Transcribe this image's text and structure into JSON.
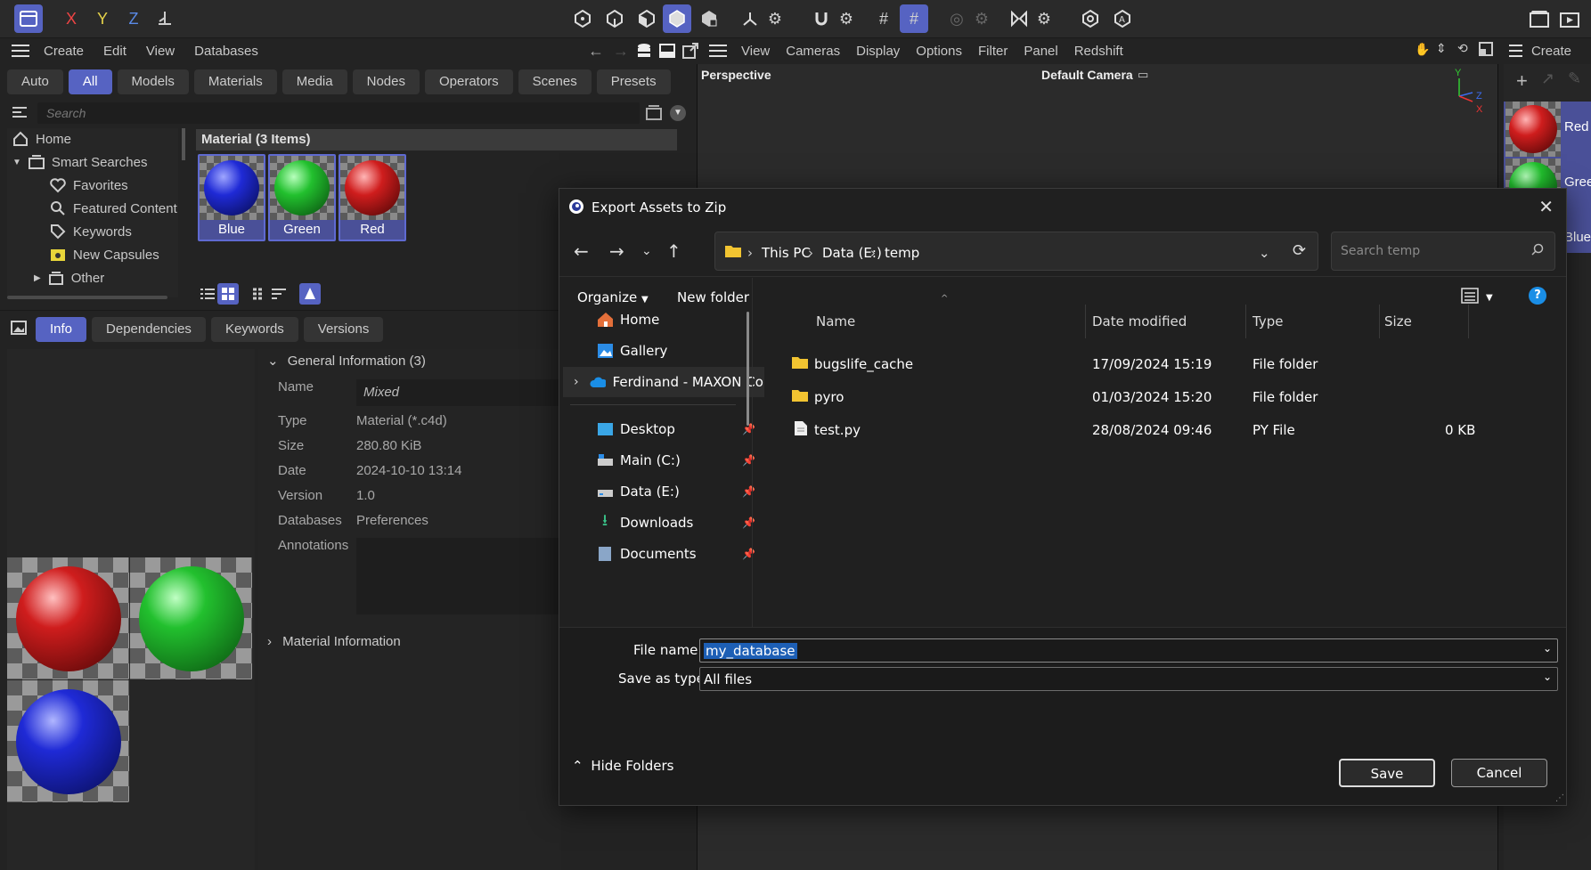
{
  "top_toolbar": {
    "axes": [
      "X",
      "Y",
      "Z"
    ]
  },
  "asset_browser": {
    "menu": [
      "Create",
      "Edit",
      "View",
      "Databases"
    ],
    "filter_tabs": [
      "Auto",
      "All",
      "Models",
      "Materials",
      "Media",
      "Nodes",
      "Operators",
      "Scenes",
      "Presets"
    ],
    "active_filter": "All",
    "search_placeholder": "Search",
    "tree": [
      "Home",
      "Smart Searches",
      "Favorites",
      "Featured Content",
      "Keywords",
      "New Capsules",
      "Other"
    ],
    "group_header": "Material (3 Items)",
    "materials": [
      {
        "name": "Blue",
        "color": "#1f2ad6"
      },
      {
        "name": "Green",
        "color": "#22c02e"
      },
      {
        "name": "Red",
        "color": "#cf1d1d"
      }
    ],
    "info_tabs": [
      "Info",
      "Dependencies",
      "Keywords",
      "Versions"
    ],
    "active_info_tab": "Info",
    "general_section": "General Information (3)",
    "material_section": "Material Information",
    "properties": [
      {
        "label": "Name",
        "value": "Mixed"
      },
      {
        "label": "Type",
        "value": "Material (*.c4d)"
      },
      {
        "label": "Size",
        "value": "280.80 KiB"
      },
      {
        "label": "Date",
        "value": "2024-10-10 13:14"
      },
      {
        "label": "Version",
        "value": "1.0"
      },
      {
        "label": "Databases",
        "value": "Preferences"
      },
      {
        "label": "Annotations",
        "value": ""
      }
    ]
  },
  "viewport": {
    "menu": [
      "View",
      "Cameras",
      "Display",
      "Options",
      "Filter",
      "Panel",
      "Redshift"
    ],
    "label": "Perspective",
    "camera": "Default Camera",
    "axis_labels": [
      "Y",
      "Z",
      "X"
    ]
  },
  "right_panel": {
    "menu": "Create",
    "items": [
      "Red",
      "Gree",
      "Blue"
    ]
  },
  "dialog": {
    "title": "Export Assets to Zip",
    "breadcrumb": [
      "This PC",
      "Data (E:)",
      "temp"
    ],
    "search_placeholder": "Search temp",
    "organize": "Organize",
    "new_folder": "New folder",
    "nav_items": [
      {
        "label": "Home",
        "pinned": false
      },
      {
        "label": "Gallery",
        "pinned": false
      },
      {
        "label": "Ferdinand - MAXON Co",
        "pinned": false
      },
      {
        "label": "Desktop",
        "pinned": true
      },
      {
        "label": "Main (C:)",
        "pinned": true
      },
      {
        "label": "Data (E:)",
        "pinned": true
      },
      {
        "label": "Downloads",
        "pinned": true
      },
      {
        "label": "Documents",
        "pinned": true
      }
    ],
    "columns": [
      "Name",
      "Date modified",
      "Type",
      "Size"
    ],
    "files": [
      {
        "name": "bugslife_cache",
        "date": "17/09/2024 15:19",
        "type": "File folder",
        "size": ""
      },
      {
        "name": "pyro",
        "date": "01/03/2024 15:20",
        "type": "File folder",
        "size": ""
      },
      {
        "name": "test.py",
        "date": "28/08/2024 09:46",
        "type": "PY File",
        "size": "0 KB"
      }
    ],
    "file_name_label": "File name:",
    "file_name_value": "my_database",
    "save_type_label": "Save as type:",
    "save_type_value": "All files",
    "hide_folders": "Hide Folders",
    "save": "Save",
    "cancel": "Cancel"
  },
  "colors": {
    "accent": "#5663c2",
    "dialog_bg": "#202020",
    "help": "#1a8ee6"
  }
}
